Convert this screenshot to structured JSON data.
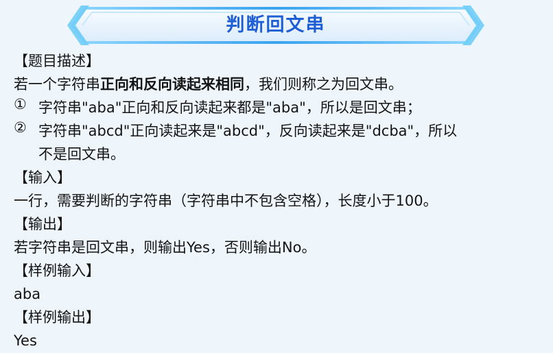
{
  "banner": {
    "title": "判断回文串"
  },
  "sections": {
    "description_heading": "【题目描述】",
    "description_line_1": {
      "prefix": "若一个字符串",
      "bold": "正向和反向读起来相同",
      "suffix": "，我们则称之为回文串。"
    },
    "examples": [
      {
        "marker": "①",
        "text": "字符串\"aba\"正向和反向读起来都是\"aba\"，所以是回文串；"
      },
      {
        "marker": "②",
        "text_line_1": "字符串\"abcd\"正向读起来是\"abcd\"，反向读起来是\"dcba\"，所以",
        "text_line_2": "不是回文串。"
      }
    ],
    "input_heading": "【输入】",
    "input_text": "一行，需要判断的字符串（字符串中不包含空格），长度小于100。",
    "output_heading": "【输出】",
    "output_text": "若字符串是回文串，则输出Yes，否则输出No。",
    "sample_input_heading": "【样例输入】",
    "sample_input_value": "aba",
    "sample_output_heading": "【样例输出】",
    "sample_output_value": "Yes"
  },
  "colors": {
    "page_background": "#eef5fb",
    "banner_title": "#1f5fd6",
    "banner_fill": "#f4f9ff",
    "banner_outline": "#55bff0"
  }
}
